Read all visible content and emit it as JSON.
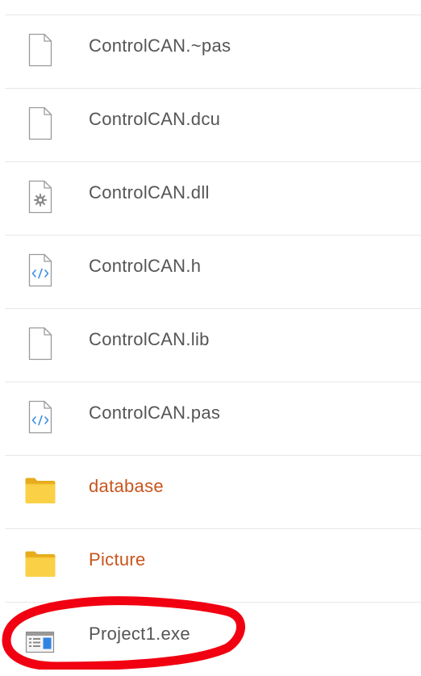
{
  "colors": {
    "file_name": "#555555",
    "folder_name": "#c9541c",
    "folder_icon": "#f8c73a",
    "code_icon_accent": "#3a8ee6",
    "divider": "#e7e7e7",
    "annotation": "#f00010"
  },
  "files": [
    {
      "name": "ControlCAN.~pas",
      "icon": "blank-file-icon",
      "kind": "file"
    },
    {
      "name": "ControlCAN.dcu",
      "icon": "blank-file-icon",
      "kind": "file"
    },
    {
      "name": "ControlCAN.dll",
      "icon": "gear-file-icon",
      "kind": "file"
    },
    {
      "name": "ControlCAN.h",
      "icon": "code-file-icon",
      "kind": "file"
    },
    {
      "name": "ControlCAN.lib",
      "icon": "blank-file-icon",
      "kind": "file"
    },
    {
      "name": "ControlCAN.pas",
      "icon": "code-file-icon",
      "kind": "file"
    },
    {
      "name": "database",
      "icon": "folder-icon",
      "kind": "folder"
    },
    {
      "name": "Picture",
      "icon": "folder-icon",
      "kind": "folder"
    },
    {
      "name": "Project1.exe",
      "icon": "application-window-icon",
      "kind": "file",
      "circled": true
    }
  ]
}
